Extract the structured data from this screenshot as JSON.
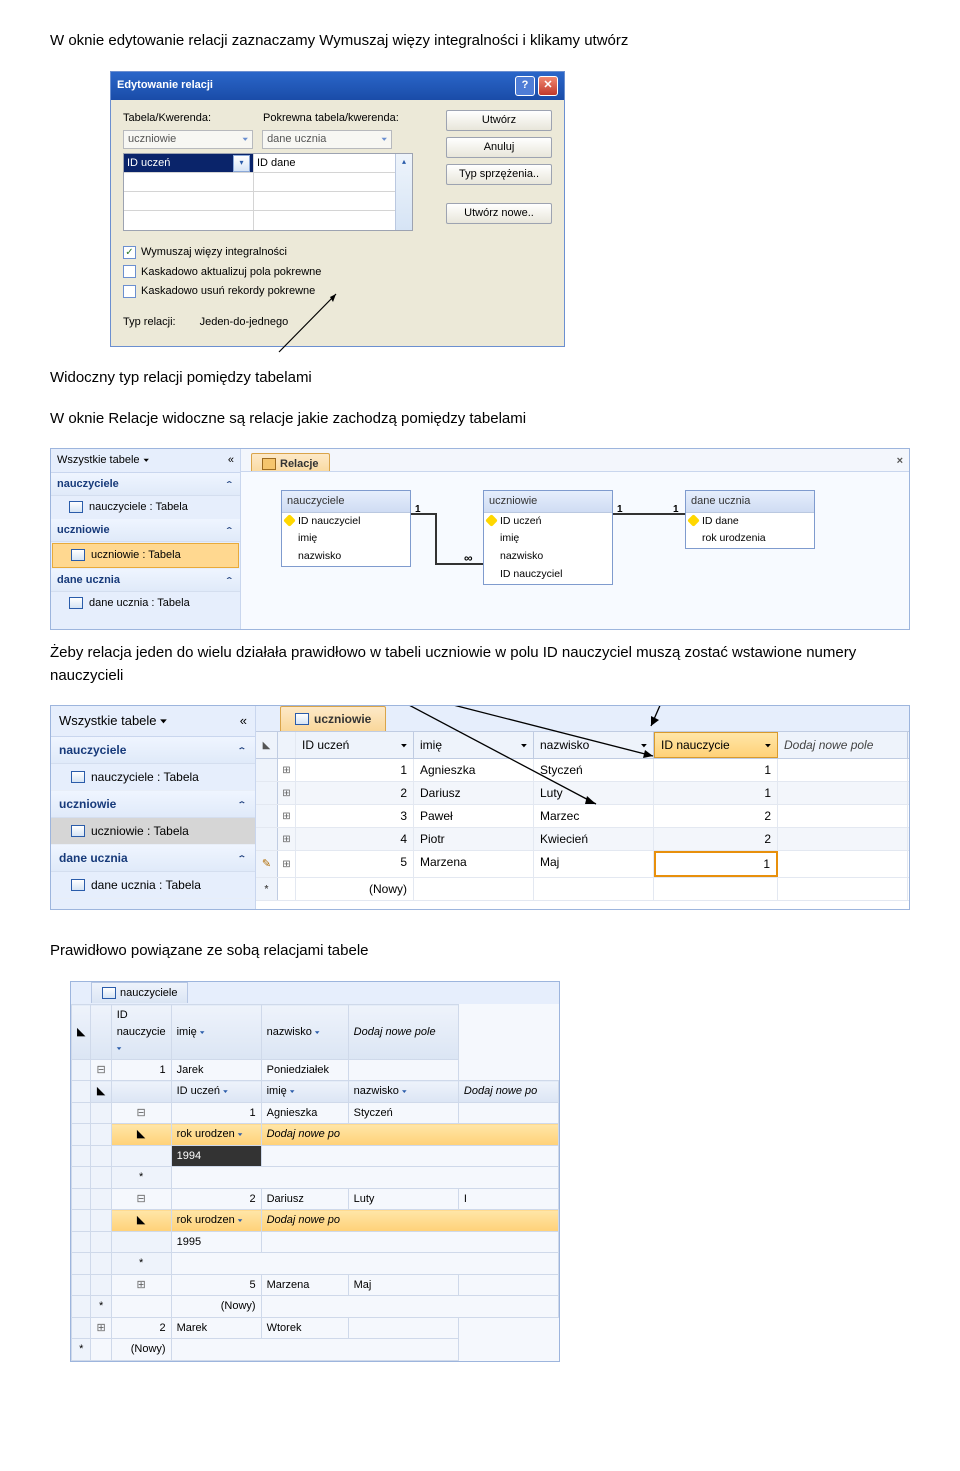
{
  "para1": "W oknie edytowanie relacji zaznaczamy Wymuszaj więzy integralności i klikamy utwórz",
  "dialog": {
    "title": "Edytowanie relacji",
    "lbl_table": "Tabela/Kwerenda:",
    "lbl_related": "Pokrewna tabela/kwerenda:",
    "sel_left": "uczniowie",
    "sel_right": "dane ucznia",
    "grid_l1": "ID uczeń",
    "grid_r1": "ID dane",
    "chk1": "Wymuszaj więzy integralności",
    "chk2": "Kaskadowo aktualizuj pola pokrewne",
    "chk3": "Kaskadowo usuń rekordy pokrewne",
    "typ_label": "Typ relacji:",
    "typ_value": "Jeden-do-jednego",
    "btn_create": "Utwórz",
    "btn_cancel": "Anuluj",
    "btn_join": "Typ sprzężenia..",
    "btn_new": "Utwórz nowe.."
  },
  "para2": "Widoczny typ relacji pomiędzy tabelami",
  "para3": "W oknie Relacje widoczne są relacje jakie zachodzą pomiędzy tabelami",
  "rel": {
    "nav_title": "Wszystkie tabele",
    "groups": [
      {
        "name": "nauczyciele",
        "item": "nauczyciele : Tabela",
        "sel": false
      },
      {
        "name": "uczniowie",
        "item": "uczniowie : Tabela",
        "sel": true
      },
      {
        "name": "dane ucznia",
        "item": "dane ucznia : Tabela",
        "sel": false
      }
    ],
    "tab": "Relacje",
    "ent1": {
      "title": "nauczyciele",
      "fields": [
        "ID nauczyciel",
        "imię",
        "nazwisko"
      ]
    },
    "ent2": {
      "title": "uczniowie",
      "fields": [
        "ID uczeń",
        "imię",
        "nazwisko",
        "ID nauczyciel"
      ]
    },
    "ent3": {
      "title": "dane ucznia",
      "fields": [
        "ID dane",
        "rok urodzenia"
      ]
    }
  },
  "para4": "Żeby relacja jeden do wielu działała prawidłowo w tabeli uczniowie w polu ID nauczyciel muszą zostać wstawione numery nauczycieli",
  "ds": {
    "nav_title": "Wszystkie tabele",
    "groups": [
      {
        "name": "nauczyciele",
        "item": "nauczyciele : Tabela",
        "sel": false
      },
      {
        "name": "uczniowie",
        "item": "uczniowie : Tabela",
        "sel": true
      },
      {
        "name": "dane ucznia",
        "item": "dane ucznia : Tabela",
        "sel": false
      }
    ],
    "tab": "uczniowie",
    "headers": [
      "ID uczeń",
      "imię",
      "nazwisko",
      "ID nauczycie",
      "Dodaj nowe pole"
    ],
    "rows": [
      {
        "id": "1",
        "im": "Agnieszka",
        "na": "Styczeń",
        "nac": "1"
      },
      {
        "id": "2",
        "im": "Dariusz",
        "na": "Luty",
        "nac": "1"
      },
      {
        "id": "3",
        "im": "Paweł",
        "na": "Marzec",
        "nac": "2"
      },
      {
        "id": "4",
        "im": "Piotr",
        "na": "Kwiecień",
        "nac": "2"
      },
      {
        "id": "5",
        "im": "Marzena",
        "na": "Maj",
        "nac": "1"
      }
    ],
    "new_row": "(Nowy)"
  },
  "para5": "Prawidłowo powiązane ze sobą relacjami tabele",
  "nest": {
    "tab": "nauczyciele",
    "h1": [
      "ID nauczycie",
      "imię",
      "nazwisko",
      "Dodaj nowe pole"
    ],
    "r1": {
      "id": "1",
      "im": "Jarek",
      "na": "Poniedziałek"
    },
    "h2": [
      "ID uczeń",
      "imię",
      "nazwisko",
      "Dodaj nowe po"
    ],
    "r2a": {
      "id": "1",
      "im": "Agnieszka",
      "na": "Styczeń"
    },
    "h3": [
      "rok urodzen",
      "Dodaj nowe po"
    ],
    "yr1": "1994",
    "r2b": {
      "id": "2",
      "im": "Dariusz",
      "na": "Luty"
    },
    "yr2": "1995",
    "r2c": {
      "id": "5",
      "im": "Marzena",
      "na": "Maj"
    },
    "new": "(Nowy)",
    "r1b": {
      "id": "2",
      "im": "Marek",
      "na": "Wtorek"
    }
  }
}
